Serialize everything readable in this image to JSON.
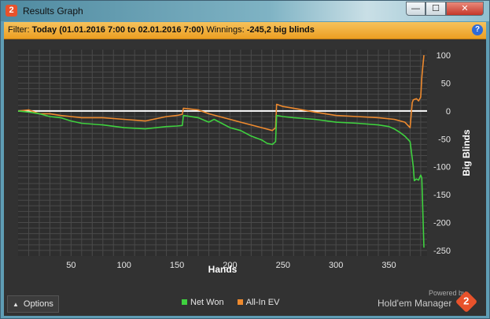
{
  "window": {
    "title": "Results Graph",
    "app_icon": "2",
    "controls": {
      "minimize": "—",
      "maximize": "☐",
      "close": "✕"
    }
  },
  "filter_bar": {
    "filter_label": "Filter:",
    "filter_value": "Today (01.01.2016 7:00 to 02.01.2016 7:00)",
    "winnings_label": "Winnings:",
    "winnings_value": "-245,2 big blinds",
    "help_icon": "?"
  },
  "footer": {
    "options_label": "Options",
    "options_caret": "▲",
    "powered_by": "Powered by",
    "brand": "Hold'em Manager",
    "brand_icon": "2"
  },
  "colors": {
    "net_won": "#3fd13f",
    "all_in_ev": "#ee8a2e",
    "zero_line": "#ffffff",
    "grid": "#4a4a4a",
    "accent": "#f0a830"
  },
  "chart_data": {
    "type": "line",
    "xlabel": "Hands",
    "ylabel": "Big Blinds",
    "xlim": [
      0,
      386
    ],
    "ylim": [
      -260,
      110
    ],
    "x_ticks": [
      50,
      100,
      150,
      200,
      250,
      300,
      350
    ],
    "y_ticks": [
      100,
      50,
      0,
      -50,
      -100,
      -150,
      -200,
      -250
    ],
    "grid": true,
    "legend_position": "bottom",
    "series": [
      {
        "name": "Net Won",
        "x": [
          0,
          10,
          20,
          30,
          40,
          50,
          60,
          80,
          100,
          120,
          140,
          150,
          155,
          156,
          170,
          180,
          185,
          200,
          210,
          220,
          230,
          235,
          240,
          243,
          244,
          250,
          260,
          280,
          300,
          320,
          340,
          350,
          355,
          360,
          365,
          370,
          373,
          374,
          376,
          378,
          380,
          381,
          382,
          383
        ],
        "y": [
          0,
          -2,
          -5,
          -10,
          -12,
          -18,
          -22,
          -25,
          -30,
          -32,
          -28,
          -27,
          -26,
          -8,
          -12,
          -20,
          -15,
          -30,
          -35,
          -45,
          -52,
          -58,
          -60,
          -55,
          -8,
          -10,
          -12,
          -15,
          -20,
          -22,
          -25,
          -28,
          -32,
          -38,
          -45,
          -55,
          -100,
          -125,
          -122,
          -124,
          -115,
          -120,
          -180,
          -245
        ]
      },
      {
        "name": "All-In EV",
        "x": [
          0,
          10,
          20,
          30,
          40,
          50,
          60,
          80,
          100,
          120,
          140,
          150,
          155,
          156,
          170,
          180,
          190,
          200,
          210,
          220,
          230,
          240,
          243,
          244,
          250,
          260,
          280,
          300,
          320,
          340,
          355,
          365,
          370,
          372,
          373,
          376,
          378,
          380,
          381,
          382,
          383
        ],
        "y": [
          0,
          2,
          -5,
          -5,
          -8,
          -10,
          -12,
          -12,
          -15,
          -18,
          -10,
          -8,
          -6,
          5,
          2,
          -5,
          -10,
          -15,
          -20,
          -25,
          -30,
          -35,
          -30,
          12,
          8,
          5,
          -2,
          -8,
          -10,
          -12,
          -15,
          -20,
          -30,
          15,
          20,
          22,
          18,
          25,
          60,
          80,
          100
        ]
      }
    ]
  }
}
